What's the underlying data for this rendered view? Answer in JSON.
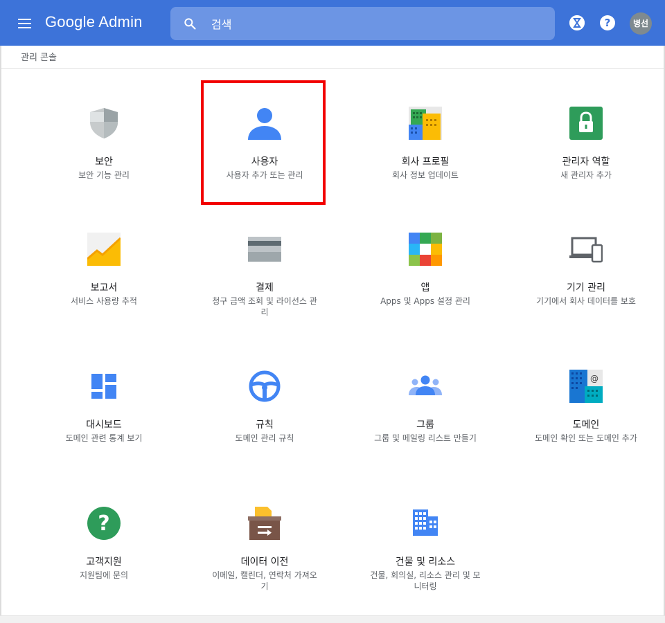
{
  "header": {
    "logo": "Google Admin",
    "search_placeholder": "검색",
    "avatar_label": "병선",
    "help_label": "?"
  },
  "breadcrumb": "관리 콘솔",
  "cards": [
    {
      "title": "보안",
      "desc": "보안 기능 관리",
      "icon": "shield-icon"
    },
    {
      "title": "사용자",
      "desc": "사용자 추가 또는 관리",
      "icon": "user-icon",
      "highlighted": true
    },
    {
      "title": "회사 프로필",
      "desc": "회사 정보 업데이트",
      "icon": "company-building-icon"
    },
    {
      "title": "관리자 역할",
      "desc": "새 관리자 추가",
      "icon": "lock-icon"
    },
    {
      "title": "보고서",
      "desc": "서비스 사용량 추적",
      "icon": "report-chart-icon"
    },
    {
      "title": "결제",
      "desc": "청구 금액 조회 및 라이선스 관리",
      "icon": "credit-card-icon"
    },
    {
      "title": "앱",
      "desc": "Apps 및 Apps 설정 관리",
      "icon": "apps-grid-icon"
    },
    {
      "title": "기기 관리",
      "desc": "기기에서 회사 데이터를 보호",
      "icon": "devices-icon"
    },
    {
      "title": "대시보드",
      "desc": "도메인 관련 통계 보기",
      "icon": "dashboard-icon"
    },
    {
      "title": "규칙",
      "desc": "도메인 관리 규칙",
      "icon": "steering-wheel-icon"
    },
    {
      "title": "그룹",
      "desc": "그룹 및 메일링 리스트 만들기",
      "icon": "groups-icon"
    },
    {
      "title": "도메인",
      "desc": "도메인 확인 또는 도메인 추가",
      "icon": "domain-icon"
    },
    {
      "title": "고객지원",
      "desc": "지원팀에 문의",
      "icon": "help-circle-icon"
    },
    {
      "title": "데이터 이전",
      "desc": "이메일, 캘린더, 연락처 가져오기",
      "icon": "data-migration-icon"
    },
    {
      "title": "건물 및 리소스",
      "desc": "건물, 회의실, 리소스 관리 및 모니터링",
      "icon": "building-icon"
    }
  ]
}
